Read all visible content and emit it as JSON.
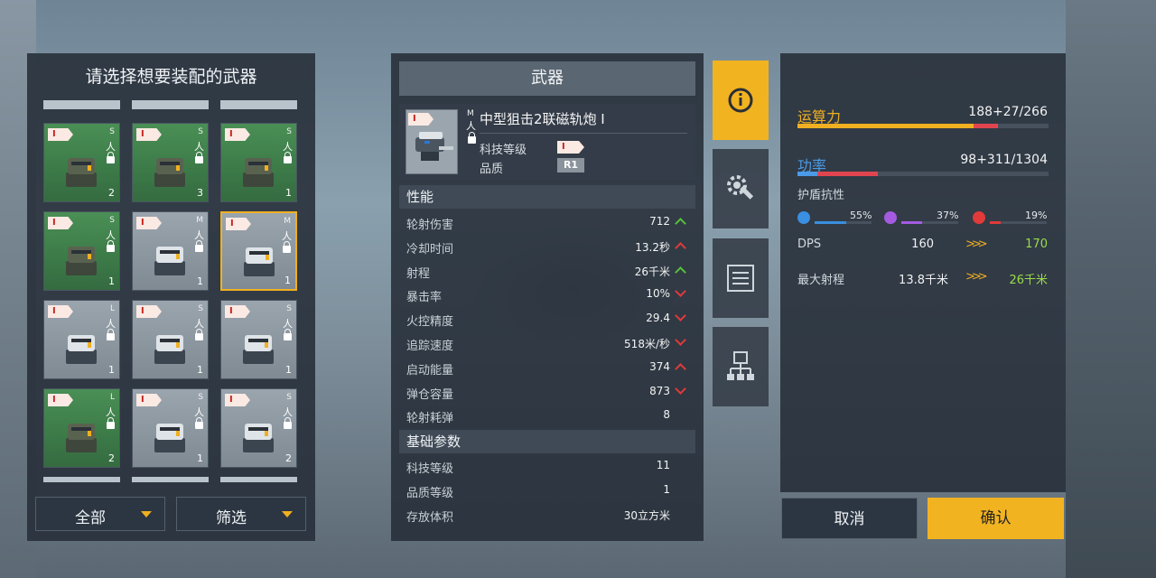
{
  "left_panel": {
    "title": "请选择想要装配的武器",
    "filter_all": "全部",
    "filter_screen": "筛选",
    "tiles": [
      {
        "tier": "I",
        "size": "S",
        "count": "2",
        "color": "green",
        "locked": true,
        "selected": false
      },
      {
        "tier": "I",
        "size": "S",
        "count": "3",
        "color": "green",
        "locked": true,
        "selected": false
      },
      {
        "tier": "I",
        "size": "S",
        "count": "1",
        "color": "green",
        "locked": true,
        "selected": false
      },
      {
        "tier": "I",
        "size": "S",
        "count": "1",
        "color": "green",
        "locked": true,
        "selected": false
      },
      {
        "tier": "I",
        "size": "M",
        "count": "1",
        "color": "grey",
        "locked": true,
        "selected": false
      },
      {
        "tier": "I",
        "size": "M",
        "count": "1",
        "color": "grey",
        "locked": true,
        "selected": true
      },
      {
        "tier": "I",
        "size": "L",
        "count": "1",
        "color": "grey",
        "locked": true,
        "selected": false
      },
      {
        "tier": "I",
        "size": "S",
        "count": "1",
        "color": "grey",
        "locked": true,
        "selected": false
      },
      {
        "tier": "I",
        "size": "S",
        "count": "1",
        "color": "grey",
        "locked": true,
        "selected": false
      },
      {
        "tier": "I",
        "size": "L",
        "count": "2",
        "color": "green",
        "locked": true,
        "selected": false
      },
      {
        "tier": "I",
        "size": "S",
        "count": "1",
        "color": "grey",
        "locked": true,
        "selected": false
      },
      {
        "tier": "I",
        "size": "S",
        "count": "2",
        "color": "grey",
        "locked": true,
        "selected": false
      }
    ]
  },
  "weapon": {
    "panel_title": "武器",
    "name": "中型狙击2联磁轨炮 I",
    "tier": "I",
    "size": "M",
    "tech_level_label": "科技等级",
    "quality_label": "品质",
    "quality": "R1",
    "performance_header": "性能",
    "stats": [
      {
        "name": "轮射伤害",
        "value": "712",
        "trend": "up"
      },
      {
        "name": "冷却时间",
        "value": "13.2秒",
        "trend": "up-bad"
      },
      {
        "name": "射程",
        "value": "26千米",
        "trend": "up"
      },
      {
        "name": "暴击率",
        "value": "10%",
        "trend": "down"
      },
      {
        "name": "火控精度",
        "value": "29.4",
        "trend": "down"
      },
      {
        "name": "追踪速度",
        "value": "518米/秒",
        "trend": "down"
      },
      {
        "name": "启动能量",
        "value": "374",
        "trend": "up-bad"
      },
      {
        "name": "弹仓容量",
        "value": "873",
        "trend": "down"
      },
      {
        "name": "轮射耗弹",
        "value": "8",
        "trend": "none"
      }
    ],
    "base_header": "基础参数",
    "base": [
      {
        "name": "科技等级",
        "value": "11"
      },
      {
        "name": "品质等级",
        "value": "1"
      },
      {
        "name": "存放体积",
        "value": "30立方米"
      }
    ]
  },
  "tabs": [
    {
      "name": "info",
      "icon": "info-icon"
    },
    {
      "name": "modules",
      "icon": "gear-wrench-icon"
    },
    {
      "name": "list",
      "icon": "list-icon"
    },
    {
      "name": "network",
      "icon": "network-icon"
    }
  ],
  "right_panel": {
    "computing_label": "运算力",
    "computing_value": "188+27/266",
    "computing_fill": 0.7,
    "computing_added": 0.1,
    "power_label": "功率",
    "power_value": "98+311/1304",
    "power_fill": 0.08,
    "power_added": 0.24,
    "shield_label": "护盾抗性",
    "resistances": [
      {
        "icon": "lightning-icon",
        "color": "#3a8fe0",
        "pct": "55%",
        "fill": 0.55
      },
      {
        "icon": "energy-icon",
        "color": "#a45be0",
        "pct": "37%",
        "fill": 0.37
      },
      {
        "icon": "fire-icon",
        "color": "#e03a3a",
        "pct": "19%",
        "fill": 0.19
      }
    ],
    "dps_label": "DPS",
    "dps_old": "160",
    "dps_new": "170",
    "range_label": "最大射程",
    "range_old": "13.8千米",
    "range_new": "26千米",
    "arrows": ">>>",
    "cancel": "取消",
    "confirm": "确认"
  },
  "colors": {
    "accent": "#f2b321",
    "computing": "#f0b021",
    "power": "#e0454f",
    "power_label": "#4a9be8"
  }
}
